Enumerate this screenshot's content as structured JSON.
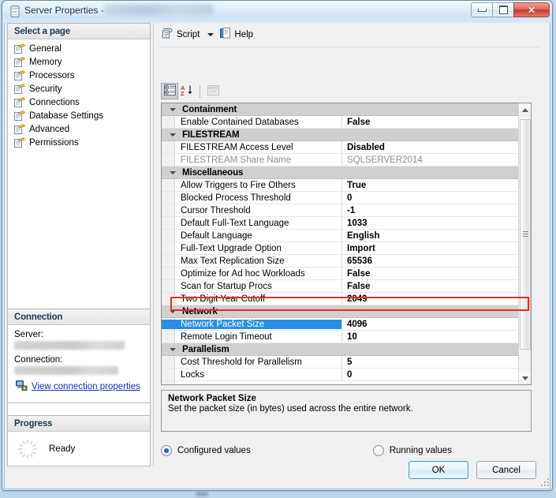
{
  "window": {
    "title": "Server Properties -",
    "title_redacted": true,
    "icon": "server-properties-icon",
    "buttons": {
      "minimize": "minimize-icon",
      "maximize": "maximize-icon",
      "close": "✕"
    }
  },
  "left_pane": {
    "header": "Select a page",
    "items": [
      {
        "label": "General",
        "icon": "page-icon"
      },
      {
        "label": "Memory",
        "icon": "page-icon"
      },
      {
        "label": "Processors",
        "icon": "page-icon"
      },
      {
        "label": "Security",
        "icon": "page-icon"
      },
      {
        "label": "Connections",
        "icon": "page-icon"
      },
      {
        "label": "Database Settings",
        "icon": "page-icon"
      },
      {
        "label": "Advanced",
        "icon": "page-icon"
      },
      {
        "label": "Permissions",
        "icon": "page-icon"
      }
    ],
    "connection": {
      "header": "Connection",
      "server_label": "Server:",
      "server_value": "",
      "connection_label": "Connection:",
      "connection_value": "",
      "link": "View connection properties",
      "link_icon": "connection-properties-icon"
    },
    "progress": {
      "header": "Progress",
      "status": "Ready",
      "icon": "progress-spinner-icon"
    }
  },
  "toolbar": {
    "script_label": "Script",
    "script_icon": "script-icon",
    "dropdown_icon": "chevron-down-icon",
    "help_label": "Help",
    "help_icon": "help-icon"
  },
  "grid_toolbar": {
    "categorized": "categorized-view-icon",
    "alphabetical": "alphabetical-sort-icon",
    "property_pages": "property-pages-icon"
  },
  "grid": {
    "rows": [
      {
        "type": "category",
        "name": "Containment"
      },
      {
        "type": "property",
        "name": "Enable Contained Databases",
        "value": "False"
      },
      {
        "type": "category",
        "name": "FILESTREAM"
      },
      {
        "type": "property",
        "name": "FILESTREAM Access Level",
        "value": "Disabled"
      },
      {
        "type": "property",
        "name": "FILESTREAM Share Name",
        "value": "SQLSERVER2014",
        "disabled": true
      },
      {
        "type": "category",
        "name": "Miscellaneous"
      },
      {
        "type": "property",
        "name": "Allow Triggers to Fire Others",
        "value": "True"
      },
      {
        "type": "property",
        "name": "Blocked Process Threshold",
        "value": "0"
      },
      {
        "type": "property",
        "name": "Cursor Threshold",
        "value": "-1"
      },
      {
        "type": "property",
        "name": "Default Full-Text Language",
        "value": "1033"
      },
      {
        "type": "property",
        "name": "Default Language",
        "value": "English"
      },
      {
        "type": "property",
        "name": "Full-Text Upgrade Option",
        "value": "Import"
      },
      {
        "type": "property",
        "name": "Max Text Replication Size",
        "value": "65536"
      },
      {
        "type": "property",
        "name": "Optimize for Ad hoc Workloads",
        "value": "False"
      },
      {
        "type": "property",
        "name": "Scan for Startup Procs",
        "value": "False"
      },
      {
        "type": "property",
        "name": "Two Digit Year Cutoff",
        "value": "2049"
      },
      {
        "type": "category",
        "name": "Network"
      },
      {
        "type": "property",
        "name": "Network Packet Size",
        "value": "4096",
        "selected": true,
        "annotated": true
      },
      {
        "type": "property",
        "name": "Remote Login Timeout",
        "value": "10"
      },
      {
        "type": "category",
        "name": "Parallelism"
      },
      {
        "type": "property",
        "name": "Cost Threshold for Parallelism",
        "value": "5"
      },
      {
        "type": "property",
        "name": "Locks",
        "value": "0"
      }
    ],
    "annotation_color": "#ec2b22",
    "selection_color": "#2a8fe0"
  },
  "description": {
    "title": "Network Packet Size",
    "text": "Set the packet size (in bytes) used across the entire network."
  },
  "values_mode": {
    "configured_label": "Configured values",
    "configured_selected": true,
    "running_label": "Running values",
    "running_selected": false
  },
  "footer": {
    "ok_label": "OK",
    "cancel_label": "Cancel"
  }
}
